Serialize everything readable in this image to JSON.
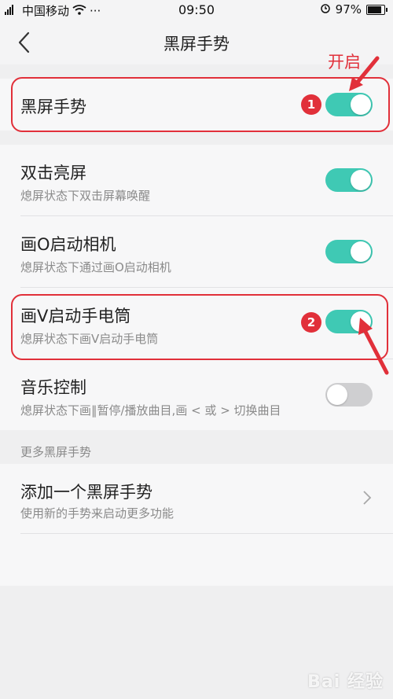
{
  "status_bar": {
    "carrier": "中国移动",
    "dots": "···",
    "time": "09:50",
    "battery": "97%"
  },
  "header": {
    "title": "黑屏手势"
  },
  "main_gesture": {
    "title": "黑屏手势",
    "enabled": true
  },
  "gestures": [
    {
      "title": "双击亮屏",
      "subtitle": "熄屏状态下双击屏幕唤醒",
      "enabled": true
    },
    {
      "title": "画O启动相机",
      "subtitle": "熄屏状态下通过画O启动相机",
      "enabled": true
    },
    {
      "title": "画V启动手电筒",
      "subtitle": "熄屏状态下画V启动手电筒",
      "enabled": true
    },
    {
      "title": "音乐控制",
      "subtitle": "熄屏状态下画‖暂停/播放曲目,画 < 或 > 切换曲目",
      "enabled": false
    }
  ],
  "more_section": {
    "label": "更多黑屏手势",
    "add_item": {
      "title": "添加一个黑屏手势",
      "subtitle": "使用新的手势来启动更多功能"
    }
  },
  "annotations": {
    "open_label": "开启",
    "badge1": "1",
    "badge2": "2",
    "color": "#e1303a"
  },
  "watermark": "Bai 经验",
  "colors": {
    "toggle_on": "#3fc9b4",
    "toggle_off": "#cfcfd1",
    "annotation": "#e1303a"
  }
}
